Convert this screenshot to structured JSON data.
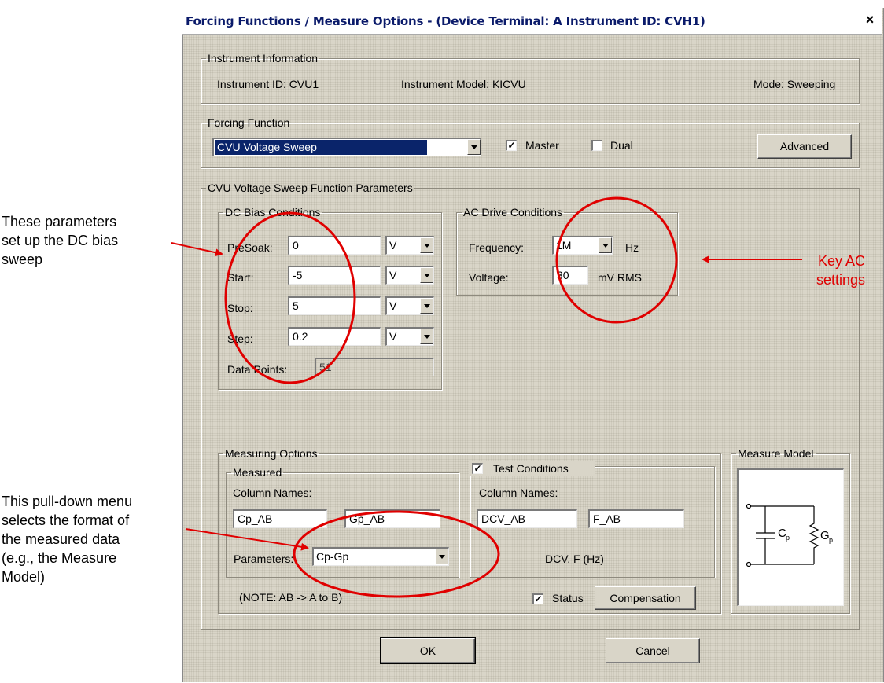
{
  "window": {
    "title": "Forcing Functions / Measure Options - (Device Terminal: A  Instrument ID: CVH1)",
    "close": "×"
  },
  "instrument_info": {
    "legend": "Instrument Information",
    "id": "Instrument ID:  CVU1",
    "model": "Instrument Model:  KICVU",
    "mode": "Mode:  Sweeping"
  },
  "forcing": {
    "legend": "Forcing Function",
    "selected": "CVU Voltage Sweep",
    "master_label": "Master",
    "master_checked": "✓",
    "dual_label": "Dual",
    "advanced": "Advanced"
  },
  "params": {
    "legend": "CVU Voltage Sweep Function Parameters"
  },
  "dc_bias": {
    "legend": "DC Bias Conditions",
    "rows": [
      {
        "label": "PreSoak:",
        "value": "0",
        "unit": "V"
      },
      {
        "label": "Start:",
        "value": "-5",
        "unit": "V"
      },
      {
        "label": "Stop:",
        "value": "5",
        "unit": "V"
      },
      {
        "label": "Step:",
        "value": "0.2",
        "unit": "V"
      }
    ],
    "data_points_label": "Data Points:",
    "data_points": "51"
  },
  "ac_drive": {
    "legend": "AC Drive Conditions",
    "frequency_label": "Frequency:",
    "frequency": "1M",
    "frequency_unit": "Hz",
    "voltage_label": "Voltage:",
    "voltage": "30",
    "voltage_unit": "mV RMS"
  },
  "measuring": {
    "legend": "Measuring Options",
    "measured_legend": "Measured",
    "column_names": "Column Names:",
    "col1": "Cp_AB",
    "col2": "Gp_AB",
    "parameters_label": "Parameters:",
    "parameters": "Cp-Gp",
    "note": "(NOTE: AB -> A to B)",
    "test_conditions_label": "Test Conditions",
    "test_checked": "✓",
    "tc_column_names": "Column Names:",
    "tc_col1": "DCV_AB",
    "tc_col2": "F_AB",
    "tc_desc": "DCV, F (Hz)",
    "status_label": "Status",
    "status_checked": "✓",
    "compensation": "Compensation"
  },
  "measure_model": {
    "legend": "Measure Model",
    "cp": "C",
    "cp_sub": "p",
    "gp": "G",
    "gp_sub": "p"
  },
  "buttons": {
    "ok": "OK",
    "cancel": "Cancel"
  },
  "annotations": {
    "dc_note": [
      "These parameters",
      "set up the DC bias",
      "sweep"
    ],
    "ac_note": [
      "Key AC",
      "settings"
    ],
    "menu_note": [
      "This pull-down menu",
      "selects the format of",
      "the measured data",
      "(e.g., the Measure",
      "Model)"
    ]
  },
  "colors": {
    "annotation": "#e00000",
    "title_text": "#0a1a6a",
    "dialog_bg": "#d9d5c8"
  }
}
